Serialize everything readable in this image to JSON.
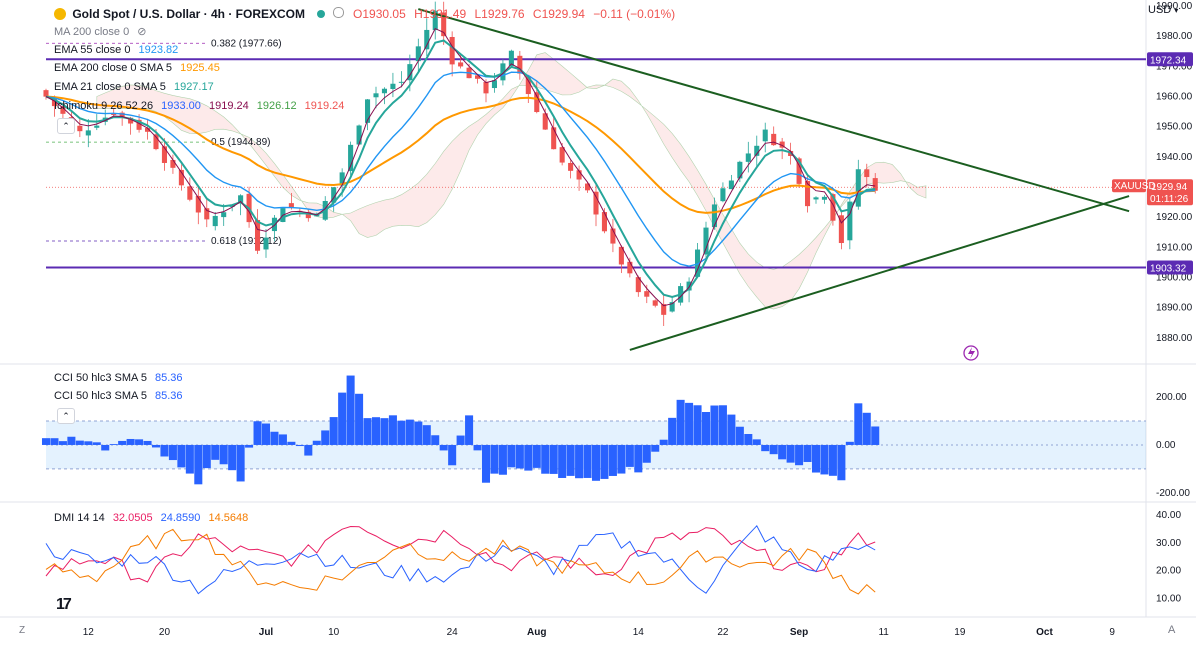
{
  "header": {
    "symbol_title": "Gold Spot / U.S. Dollar · 4h · FOREXCOM",
    "ohlc": {
      "o": "O1930.05",
      "h": "H1931.49",
      "l": "L1929.76",
      "c": "C1929.94",
      "chg": "−0.11 (−0.01%)"
    },
    "currency": "USD"
  },
  "indicators": {
    "ma200": "MA 200 close 0",
    "ema55_label": "EMA 55 close 0",
    "ema55_value": "1923.82",
    "ema200_label": "EMA 200 close 0 SMA 5",
    "ema200_value": "1925.45",
    "ema21_label": "EMA 21 close 0 SMA 5",
    "ema21_value": "1927.17",
    "ichimoku_label": "Ichimoku 9 26 52 26",
    "ichimoku_values": [
      "1933.00",
      "1919.24",
      "1926.12",
      "1919.24"
    ],
    "cci_label": "CCI 50 hlc3 SMA 5",
    "cci_value": "85.36",
    "dmi_label": "DMI 14 14",
    "dmi_values": [
      "32.0505",
      "24.8590",
      "14.5648"
    ]
  },
  "fib_labels": [
    {
      "text": "0.382 (1977.66)",
      "price": 1977.66
    },
    {
      "text": "0.5 (1944.89)",
      "price": 1944.89
    },
    {
      "text": "0.618 (1912.12)",
      "price": 1912.12
    }
  ],
  "price_tags": {
    "resistance": "1972.34",
    "support": "1903.32",
    "symbol": "XAUUSD",
    "last": "1929.94",
    "countdown": "01:11:26"
  },
  "x_axis": [
    "12",
    "20",
    "Jul",
    "10",
    "24",
    "Aug",
    "14",
    "22",
    "Sep",
    "11",
    "19",
    "Oct",
    "9"
  ],
  "x_axis_bold": [
    "Jul",
    "Aug",
    "Sep",
    "Oct"
  ],
  "bottom_left": "Z",
  "colors": {
    "up": "#26a69a",
    "down": "#ef5350",
    "ema55": "#2196f3",
    "ema200": "#ff9800",
    "ema21": "#26a69a",
    "tenkan": "#880e4f",
    "trendline": "#1b5e20",
    "hline": "#5b2bb3",
    "cci_fill": "#2962ff",
    "dmi_plus": "#e91e63",
    "dmi_minus": "#2962ff",
    "adx": "#f57c00"
  },
  "chart_data": [
    {
      "type": "candlestick",
      "title": "Gold Spot / U.S. Dollar · 4h · FOREXCOM",
      "ylim": [
        1872,
        1992
      ],
      "y_ticks": [
        1880,
        1890,
        1900,
        1910,
        1920,
        1930,
        1940,
        1950,
        1960,
        1970,
        1980,
        1990
      ],
      "x_ticks": [
        "12",
        "20",
        "Jul",
        "10",
        "24",
        "Aug",
        "14",
        "22",
        "Sep",
        "11",
        "19",
        "Oct",
        "9"
      ],
      "price_path": {
        "x": [
          0,
          4,
          8,
          12,
          15,
          19,
          23,
          25,
          28,
          32,
          35,
          38,
          42,
          46,
          48,
          52,
          55,
          58,
          61,
          64,
          67,
          70,
          73,
          76,
          79,
          82,
          85,
          88,
          90,
          92,
          94,
          96,
          98
        ],
        "y": [
          1960,
          1948,
          1955,
          1948,
          1935,
          1918,
          1927,
          1910,
          1924,
          1920,
          1935,
          1960,
          1965,
          1988,
          1972,
          1962,
          1974,
          1955,
          1938,
          1928,
          1910,
          1895,
          1888,
          1900,
          1925,
          1938,
          1948,
          1940,
          1925,
          1928,
          1912,
          1936,
          1929.94
        ]
      },
      "horizontal_lines": [
        1972.34,
        1903.32
      ],
      "trendlines": [
        {
          "x": [
            44,
            128
          ],
          "y": [
            1989,
            1922
          ]
        },
        {
          "x": [
            69,
            128
          ],
          "y": [
            1876,
            1927
          ]
        }
      ],
      "series": [
        {
          "name": "EMA 55 close 0",
          "values_last": 1923.82
        },
        {
          "name": "EMA 200 close 0 SMA 5",
          "values_last": 1925.45
        },
        {
          "name": "EMA 21 close 0 SMA 5",
          "values_last": 1927.17
        }
      ]
    },
    {
      "type": "area",
      "title": "CCI 50 hlc3 SMA 5",
      "ylim": [
        -230,
        330
      ],
      "y_ticks": [
        200.0,
        0.0,
        -200.0
      ],
      "band": [
        -100,
        100
      ],
      "path": {
        "x": [
          0,
          4,
          7,
          10,
          13,
          18,
          20,
          23,
          25,
          28,
          31,
          34,
          36,
          38,
          41,
          45,
          48,
          50,
          52,
          55,
          60,
          63,
          67,
          70,
          73,
          75,
          78,
          80,
          82,
          86,
          88,
          90,
          91,
          94,
          96,
          98
        ],
        "y": [
          20,
          30,
          -10,
          40,
          -5,
          -150,
          -60,
          -140,
          90,
          50,
          -50,
          120,
          300,
          110,
          120,
          95,
          -70,
          120,
          -150,
          -100,
          -110,
          -150,
          -120,
          -100,
          20,
          200,
          150,
          180,
          70,
          -50,
          -80,
          -60,
          -110,
          -150,
          160,
          85.36
        ]
      },
      "last": 85.36
    },
    {
      "type": "line",
      "title": "DMI 14 14",
      "ylim": [
        4,
        44
      ],
      "y_ticks": [
        40.0,
        30.0,
        20.0,
        10.0
      ],
      "series": [
        {
          "name": "+DI",
          "last": 32.0505,
          "x": [
            0,
            6,
            12,
            18,
            24,
            30,
            36,
            42,
            48,
            54,
            60,
            66,
            72,
            78,
            84,
            90,
            96,
            98
          ],
          "y": [
            20,
            25,
            17,
            32,
            26,
            24,
            38,
            30,
            34,
            22,
            25,
            19,
            30,
            34,
            26,
            19,
            31,
            32.05
          ]
        },
        {
          "name": "−DI",
          "last": 24.859,
          "x": [
            0,
            6,
            12,
            18,
            24,
            30,
            36,
            42,
            48,
            54,
            60,
            66,
            72,
            78,
            84,
            90,
            96,
            98
          ],
          "y": [
            28,
            23,
            25,
            14,
            22,
            27,
            22,
            19,
            18,
            29,
            21,
            32,
            26,
            14,
            35,
            20,
            30,
            24.86
          ]
        },
        {
          "name": "ADX",
          "last": 14.5648,
          "x": [
            0,
            6,
            12,
            18,
            24,
            30,
            36,
            42,
            48,
            54,
            60,
            66,
            72,
            78,
            84,
            90,
            96,
            98
          ],
          "y": [
            21,
            18,
            30,
            34,
            18,
            14,
            19,
            30,
            24,
            28,
            22,
            20,
            16,
            26,
            22,
            27,
            13,
            14.56
          ]
        }
      ]
    }
  ]
}
